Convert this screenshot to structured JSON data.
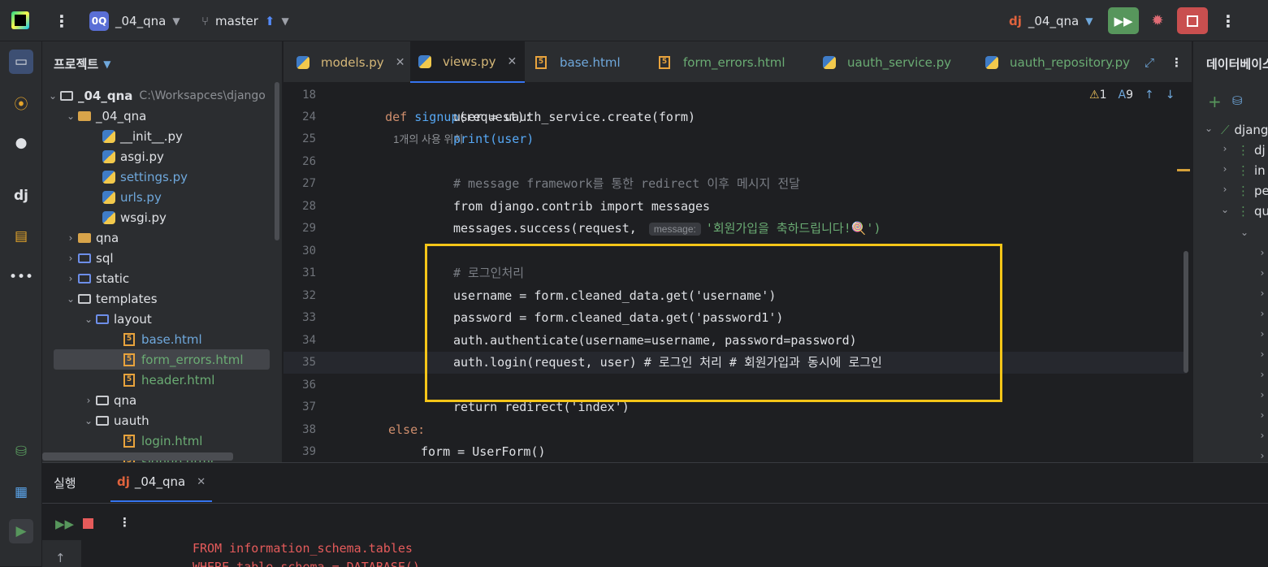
{
  "titlebar": {
    "project_badge": "0Q",
    "project_name": "_04_qna",
    "branch": "master",
    "run_config": "_04_qna"
  },
  "project_panel": {
    "title": "프로젝트",
    "root": {
      "name": "_04_qna",
      "path": "C:\\Worksapces\\django"
    },
    "items": [
      {
        "label": "_04_qna",
        "type": "folder"
      },
      {
        "label": "__init__.py",
        "type": "py"
      },
      {
        "label": "asgi.py",
        "type": "py"
      },
      {
        "label": "settings.py",
        "type": "py"
      },
      {
        "label": "urls.py",
        "type": "py"
      },
      {
        "label": "wsgi.py",
        "type": "py"
      },
      {
        "label": "qna",
        "type": "folder"
      },
      {
        "label": "sql",
        "type": "folder"
      },
      {
        "label": "static",
        "type": "folder"
      },
      {
        "label": "templates",
        "type": "folder"
      },
      {
        "label": "layout",
        "type": "folder"
      },
      {
        "label": "base.html",
        "type": "html"
      },
      {
        "label": "form_errors.html",
        "type": "html"
      },
      {
        "label": "header.html",
        "type": "html"
      },
      {
        "label": "qna",
        "type": "folder"
      },
      {
        "label": "uauth",
        "type": "folder"
      },
      {
        "label": "login.html",
        "type": "html"
      },
      {
        "label": "signup.html",
        "type": "html"
      }
    ]
  },
  "tabs": [
    {
      "label": "models.py"
    },
    {
      "label": "views.py"
    },
    {
      "label": "base.html"
    },
    {
      "label": "form_errors.html"
    },
    {
      "label": "uauth_service.py"
    },
    {
      "label": "uauth_repository.py"
    }
  ],
  "editor": {
    "sticky": {
      "line": "18",
      "code": "def signup(request):",
      "usage": "1개의 사용 위치"
    },
    "warnings": "1",
    "typos": "9",
    "hint_label": "message:",
    "lines": [
      {
        "n": "24",
        "text": "user = uauth_service.create(form)"
      },
      {
        "n": "25",
        "text": "print(user)"
      },
      {
        "n": "26",
        "text": ""
      },
      {
        "n": "27",
        "text": "# message framework를 통한 redirect 이후 메시지 전달"
      },
      {
        "n": "28",
        "text": "from django.contrib import messages"
      },
      {
        "n": "29a",
        "text": "messages.success(request, "
      },
      {
        "n": "29b",
        "text": "'회원가입을 축하드립니다!🍭')"
      },
      {
        "n": "30",
        "text": ""
      },
      {
        "n": "31",
        "text": "# 로그인처리"
      },
      {
        "n": "32",
        "text": "username = form.cleaned_data.get('username')"
      },
      {
        "n": "33",
        "text": "password = form.cleaned_data.get('password1')"
      },
      {
        "n": "34",
        "text": "auth.authenticate(username=username, password=password)"
      },
      {
        "n": "35",
        "text": "auth.login(request, user) # 로그인 처리 # 회원가입과 동시에 로그인"
      },
      {
        "n": "36",
        "text": ""
      },
      {
        "n": "37",
        "text": "return redirect('index')"
      },
      {
        "n": "38",
        "text": "else:"
      },
      {
        "n": "39",
        "text": "form = UserForm()"
      }
    ]
  },
  "right_panel": {
    "title": "데이터베이스",
    "items": [
      "django",
      "dj",
      "in",
      "pe",
      "qu"
    ]
  },
  "bottom": {
    "tab_run": "실행",
    "tab_config": "_04_qna",
    "console_line1": "FROM information_schema.tables",
    "console_line2": "WHERE table_schema = DATABASE()"
  }
}
